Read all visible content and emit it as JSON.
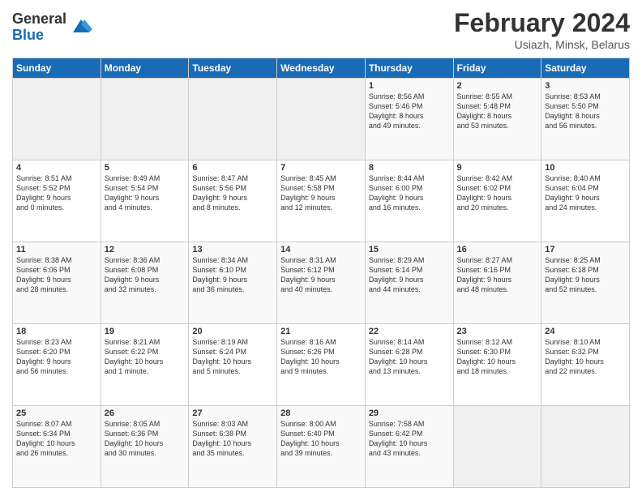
{
  "header": {
    "logo_general": "General",
    "logo_blue": "Blue",
    "title": "February 2024",
    "subtitle": "Usiazh, Minsk, Belarus"
  },
  "days_of_week": [
    "Sunday",
    "Monday",
    "Tuesday",
    "Wednesday",
    "Thursday",
    "Friday",
    "Saturday"
  ],
  "weeks": [
    [
      {
        "day": "",
        "info": ""
      },
      {
        "day": "",
        "info": ""
      },
      {
        "day": "",
        "info": ""
      },
      {
        "day": "",
        "info": ""
      },
      {
        "day": "1",
        "info": "Sunrise: 8:56 AM\nSunset: 5:46 PM\nDaylight: 8 hours\nand 49 minutes."
      },
      {
        "day": "2",
        "info": "Sunrise: 8:55 AM\nSunset: 5:48 PM\nDaylight: 8 hours\nand 53 minutes."
      },
      {
        "day": "3",
        "info": "Sunrise: 8:53 AM\nSunset: 5:50 PM\nDaylight: 8 hours\nand 56 minutes."
      }
    ],
    [
      {
        "day": "4",
        "info": "Sunrise: 8:51 AM\nSunset: 5:52 PM\nDaylight: 9 hours\nand 0 minutes."
      },
      {
        "day": "5",
        "info": "Sunrise: 8:49 AM\nSunset: 5:54 PM\nDaylight: 9 hours\nand 4 minutes."
      },
      {
        "day": "6",
        "info": "Sunrise: 8:47 AM\nSunset: 5:56 PM\nDaylight: 9 hours\nand 8 minutes."
      },
      {
        "day": "7",
        "info": "Sunrise: 8:45 AM\nSunset: 5:58 PM\nDaylight: 9 hours\nand 12 minutes."
      },
      {
        "day": "8",
        "info": "Sunrise: 8:44 AM\nSunset: 6:00 PM\nDaylight: 9 hours\nand 16 minutes."
      },
      {
        "day": "9",
        "info": "Sunrise: 8:42 AM\nSunset: 6:02 PM\nDaylight: 9 hours\nand 20 minutes."
      },
      {
        "day": "10",
        "info": "Sunrise: 8:40 AM\nSunset: 6:04 PM\nDaylight: 9 hours\nand 24 minutes."
      }
    ],
    [
      {
        "day": "11",
        "info": "Sunrise: 8:38 AM\nSunset: 6:06 PM\nDaylight: 9 hours\nand 28 minutes."
      },
      {
        "day": "12",
        "info": "Sunrise: 8:36 AM\nSunset: 6:08 PM\nDaylight: 9 hours\nand 32 minutes."
      },
      {
        "day": "13",
        "info": "Sunrise: 8:34 AM\nSunset: 6:10 PM\nDaylight: 9 hours\nand 36 minutes."
      },
      {
        "day": "14",
        "info": "Sunrise: 8:31 AM\nSunset: 6:12 PM\nDaylight: 9 hours\nand 40 minutes."
      },
      {
        "day": "15",
        "info": "Sunrise: 8:29 AM\nSunset: 6:14 PM\nDaylight: 9 hours\nand 44 minutes."
      },
      {
        "day": "16",
        "info": "Sunrise: 8:27 AM\nSunset: 6:16 PM\nDaylight: 9 hours\nand 48 minutes."
      },
      {
        "day": "17",
        "info": "Sunrise: 8:25 AM\nSunset: 6:18 PM\nDaylight: 9 hours\nand 52 minutes."
      }
    ],
    [
      {
        "day": "18",
        "info": "Sunrise: 8:23 AM\nSunset: 6:20 PM\nDaylight: 9 hours\nand 56 minutes."
      },
      {
        "day": "19",
        "info": "Sunrise: 8:21 AM\nSunset: 6:22 PM\nDaylight: 10 hours\nand 1 minute."
      },
      {
        "day": "20",
        "info": "Sunrise: 8:19 AM\nSunset: 6:24 PM\nDaylight: 10 hours\nand 5 minutes."
      },
      {
        "day": "21",
        "info": "Sunrise: 8:16 AM\nSunset: 6:26 PM\nDaylight: 10 hours\nand 9 minutes."
      },
      {
        "day": "22",
        "info": "Sunrise: 8:14 AM\nSunset: 6:28 PM\nDaylight: 10 hours\nand 13 minutes."
      },
      {
        "day": "23",
        "info": "Sunrise: 8:12 AM\nSunset: 6:30 PM\nDaylight: 10 hours\nand 18 minutes."
      },
      {
        "day": "24",
        "info": "Sunrise: 8:10 AM\nSunset: 6:32 PM\nDaylight: 10 hours\nand 22 minutes."
      }
    ],
    [
      {
        "day": "25",
        "info": "Sunrise: 8:07 AM\nSunset: 6:34 PM\nDaylight: 10 hours\nand 26 minutes."
      },
      {
        "day": "26",
        "info": "Sunrise: 8:05 AM\nSunset: 6:36 PM\nDaylight: 10 hours\nand 30 minutes."
      },
      {
        "day": "27",
        "info": "Sunrise: 8:03 AM\nSunset: 6:38 PM\nDaylight: 10 hours\nand 35 minutes."
      },
      {
        "day": "28",
        "info": "Sunrise: 8:00 AM\nSunset: 6:40 PM\nDaylight: 10 hours\nand 39 minutes."
      },
      {
        "day": "29",
        "info": "Sunrise: 7:58 AM\nSunset: 6:42 PM\nDaylight: 10 hours\nand 43 minutes."
      },
      {
        "day": "",
        "info": ""
      },
      {
        "day": "",
        "info": ""
      }
    ]
  ]
}
